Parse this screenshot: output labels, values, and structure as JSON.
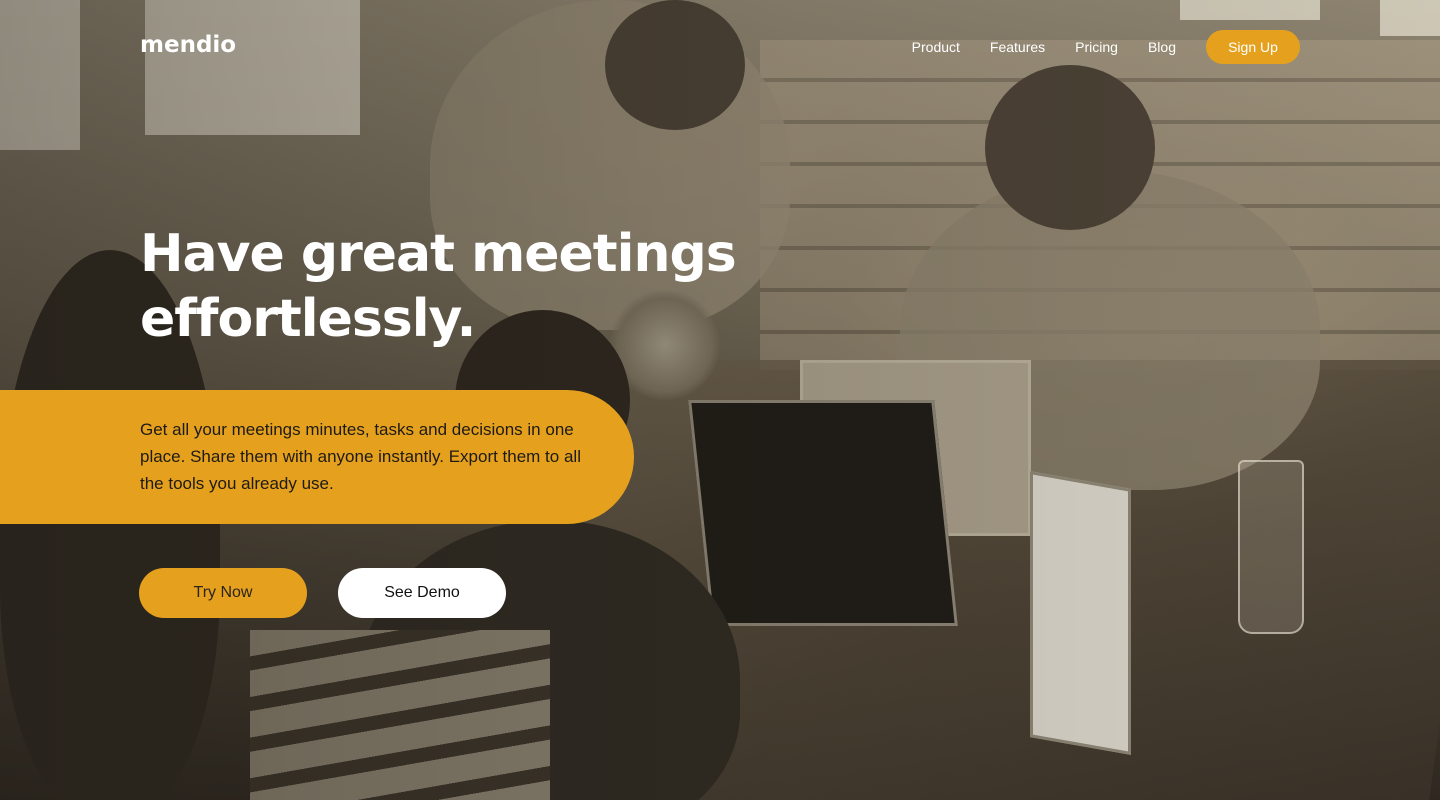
{
  "brand": {
    "logo": "mendio",
    "accent_color": "#e5a11e"
  },
  "nav": {
    "links": [
      "Product",
      "Features",
      "Pricing",
      "Blog"
    ],
    "signup_label": "Sign Up"
  },
  "hero": {
    "headline_line1": "Have great meetings",
    "headline_line2": "effortlessly.",
    "description": "Get all your meetings minutes, tasks and decisions in one place. Share them with anyone instantly. Export them to all the tools you already use.",
    "primary_cta": "Try Now",
    "secondary_cta": "See Demo"
  }
}
